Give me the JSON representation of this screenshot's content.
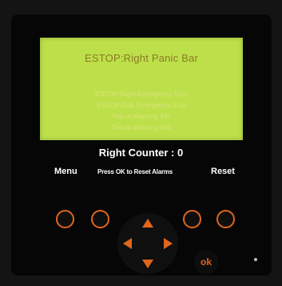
{
  "lcd": {
    "title": "ESTOP:Right Panic Bar",
    "lines": [
      "ESTOP:Right Emergency Stop",
      "ESTOP:Cab Emergency Stop",
      "This is Warning 547",
      "This is Warning 546"
    ]
  },
  "status": {
    "counter": "Right Counter : 0"
  },
  "softkeys": {
    "left": "Menu",
    "right": "Reset",
    "hint": "Press OK to Reset Alarms"
  },
  "keypad": {
    "ok_label": "ok"
  },
  "colors": {
    "accent": "#e0651d",
    "lcd_background": "#bde04a"
  }
}
